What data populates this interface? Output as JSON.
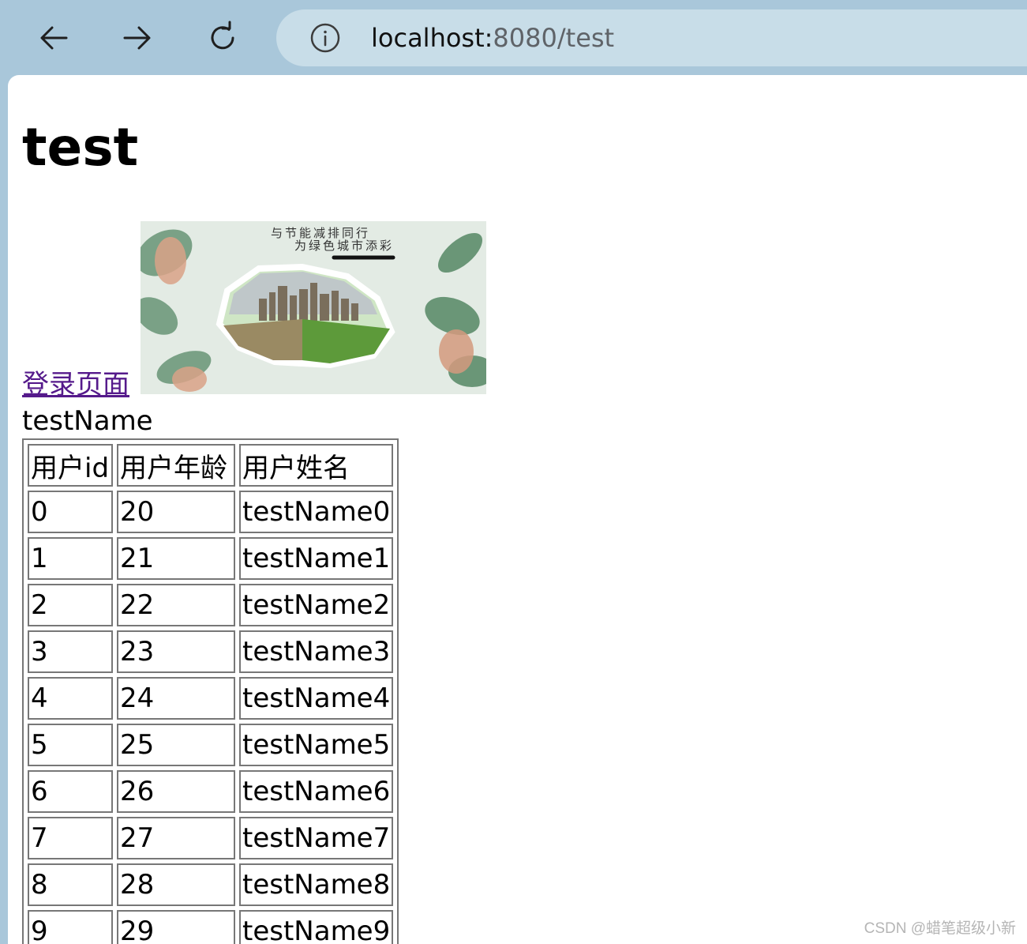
{
  "browser": {
    "url_host": "localhost:",
    "url_rest": "8080/test"
  },
  "page": {
    "title": "test",
    "login_link": "登录页面",
    "banner_caption_line1": "与节能减排同行",
    "banner_caption_line2": "为绿色城市添彩",
    "username": "testName"
  },
  "table": {
    "headers": [
      "用户id",
      "用户年龄",
      "用户姓名"
    ],
    "rows": [
      [
        "0",
        "20",
        "testName0"
      ],
      [
        "1",
        "21",
        "testName1"
      ],
      [
        "2",
        "22",
        "testName2"
      ],
      [
        "3",
        "23",
        "testName3"
      ],
      [
        "4",
        "24",
        "testName4"
      ],
      [
        "5",
        "25",
        "testName5"
      ],
      [
        "6",
        "26",
        "testName6"
      ],
      [
        "7",
        "27",
        "testName7"
      ],
      [
        "8",
        "28",
        "testName8"
      ],
      [
        "9",
        "29",
        "testName9"
      ]
    ]
  },
  "watermark": "CSDN @蜡笔超级小新",
  "colors": {
    "chrome_background": "#a9c7da",
    "address_bar": "#c8dde8",
    "visited_link": "#551a8b",
    "table_border": "#777777"
  },
  "icons": [
    "back-arrow-icon",
    "forward-arrow-icon",
    "reload-icon",
    "info-icon"
  ]
}
